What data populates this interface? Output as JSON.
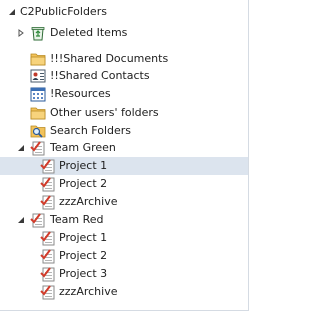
{
  "root": {
    "label": "C2PublicFolders",
    "state": "expanded"
  },
  "items": [
    {
      "label": "Deleted Items",
      "icon": "recycle-bin-icon",
      "state": "collapsed"
    },
    {
      "label": "!!!Shared Documents",
      "icon": "folder-icon"
    },
    {
      "label": "!!Shared Contacts",
      "icon": "contacts-icon"
    },
    {
      "label": "!Resources",
      "icon": "calendar-icon"
    },
    {
      "label": "Other users' folders",
      "icon": "folder-icon"
    },
    {
      "label": "Search Folders",
      "icon": "search-folder-icon"
    }
  ],
  "groups": [
    {
      "label": "Team Green",
      "icon": "tasks-icon",
      "state": "expanded",
      "children": [
        {
          "label": "Project 1",
          "icon": "tasks-icon",
          "selected": true
        },
        {
          "label": "Project 2",
          "icon": "tasks-icon"
        },
        {
          "label": "zzzArchive",
          "icon": "tasks-icon"
        }
      ]
    },
    {
      "label": "Team Red",
      "icon": "tasks-icon",
      "state": "expanded",
      "children": [
        {
          "label": "Project 1",
          "icon": "tasks-icon"
        },
        {
          "label": "Project 2",
          "icon": "tasks-icon"
        },
        {
          "label": "Project 3",
          "icon": "tasks-icon"
        },
        {
          "label": "zzzArchive",
          "icon": "tasks-icon"
        }
      ]
    }
  ],
  "colors": {
    "selection": "#dce4ee",
    "folder": "#f2c25a",
    "task_check": "#d23b2a"
  }
}
